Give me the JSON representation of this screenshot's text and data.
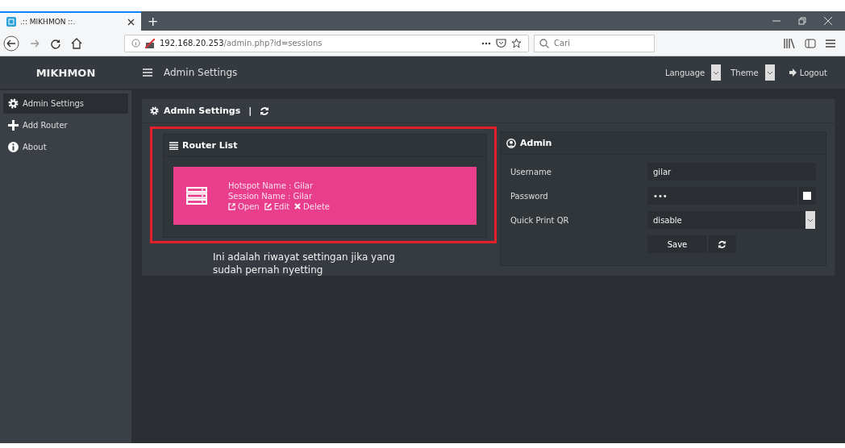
{
  "browser": {
    "tab": {
      "title": ".:: MIKHMON ::.",
      "selected": true
    },
    "new_tab": "+",
    "url_host": "192.168.20.253",
    "url_path": "/admin.php?id=sessions",
    "search": {
      "placeholder": "Cari"
    }
  },
  "header": {
    "brand": "MIKHMON",
    "title": "Admin Settings",
    "language": "Language",
    "theme": "Theme",
    "logout": "Logout"
  },
  "sidebar": {
    "items": [
      {
        "label": "Admin Settings",
        "kind": "gear",
        "selected": true
      },
      {
        "label": "Add Router",
        "kind": "plus",
        "selected": false
      },
      {
        "label": "About",
        "kind": "info",
        "selected": false
      }
    ]
  },
  "panel": {
    "title": "Admin Settings",
    "separator": "|"
  },
  "router_list": {
    "title": "Router List",
    "highlighted": true,
    "routers": [
      {
        "hotspot": "Hotspot Name : Gilar",
        "session": "Session Name : Gilar",
        "actions": [
          "Open",
          "Edit",
          "Delete"
        ]
      }
    ]
  },
  "annotation": "Ini adalah riwayat settingan jika yang sudah pernah nyetting",
  "admin": {
    "title": "Admin",
    "username_label": "Username",
    "username": "gilar",
    "password_label": "Password",
    "password": "•••",
    "show_password": {
      "checked": false
    },
    "qr_label": "Quick Print QR",
    "qr_value": "disable",
    "save": "Save"
  }
}
